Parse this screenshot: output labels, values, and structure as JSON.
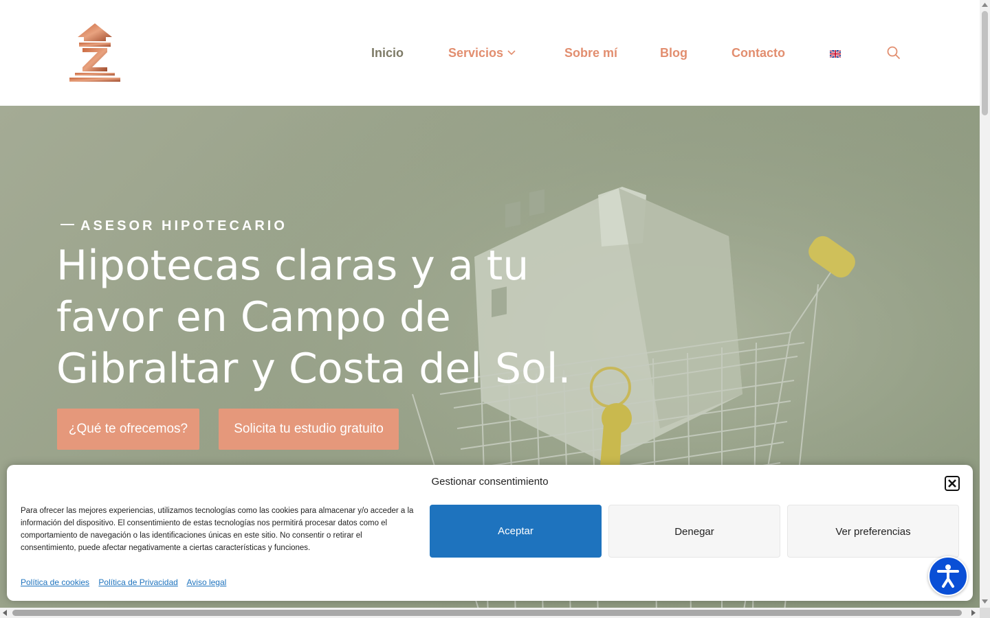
{
  "header": {
    "logo_alt": "Z",
    "nav": [
      {
        "label": "Inicio",
        "active": true
      },
      {
        "label": "Servicios",
        "has_dropdown": true
      },
      {
        "label": "Sobre mí"
      },
      {
        "label": "Blog"
      },
      {
        "label": "Contacto"
      }
    ],
    "language_icon": "uk-flag-icon",
    "search_icon": "search-icon"
  },
  "hero": {
    "eyebrow": "ASESOR HIPOTECARIO",
    "title": "Hipotecas claras y a tu favor en Campo de Gibraltar y Costa del Sol.",
    "buttons": [
      {
        "label": "¿Qué te ofrecemos?"
      },
      {
        "label": "Solicita tu estudio gratuito"
      }
    ]
  },
  "consent": {
    "title": "Gestionar consentimiento",
    "body": "Para ofrecer las mejores experiencias, utilizamos tecnologías como las cookies para almacenar y/o acceder a la información del dispositivo. El consentimiento de estas tecnologías nos permitirá procesar datos como el comportamiento de navegación o las identificaciones únicas en este sitio. No consentir o retirar el consentimiento, puede afectar negativamente a ciertas características y funciones.",
    "accept_label": "Aceptar",
    "deny_label": "Denegar",
    "prefs_label": "Ver preferencias",
    "links": [
      "Política de cookies",
      "Política de Privacidad",
      "Aviso legal"
    ]
  },
  "colors": {
    "accent": "#e28e6f",
    "button": "#e5987b",
    "primary_blue": "#1e73be",
    "hero_overlay": "#959f86"
  }
}
